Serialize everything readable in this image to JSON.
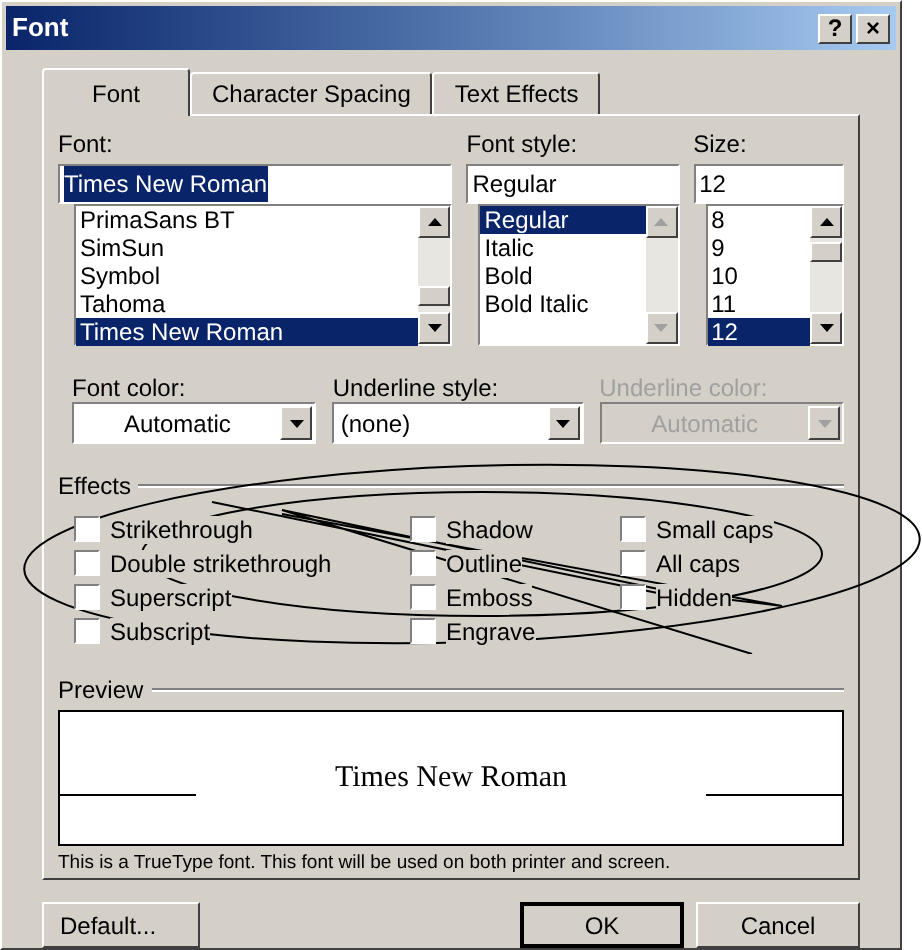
{
  "window": {
    "title": "Font",
    "buttons": [
      "?",
      "×"
    ]
  },
  "tabs": [
    {
      "label": "Font",
      "selected": true
    },
    {
      "label": "Character Spacing",
      "selected": false
    },
    {
      "label": "Text Effects",
      "selected": false
    }
  ],
  "font": {
    "label": "Font:",
    "value": "Times New Roman",
    "items": [
      {
        "label": "PrimaSans BT",
        "selected": false
      },
      {
        "label": "SimSun",
        "selected": false
      },
      {
        "label": "Symbol",
        "selected": false
      },
      {
        "label": "Tahoma",
        "selected": false
      },
      {
        "label": "Times New Roman",
        "selected": true
      }
    ]
  },
  "font_style": {
    "label": "Font style:",
    "value": "Regular",
    "items": [
      {
        "label": "Regular",
        "selected": true
      },
      {
        "label": "Italic",
        "selected": false
      },
      {
        "label": "Bold",
        "selected": false
      },
      {
        "label": "Bold Italic",
        "selected": false
      }
    ]
  },
  "size": {
    "label": "Size:",
    "value": "12",
    "items": [
      {
        "label": "8",
        "selected": false
      },
      {
        "label": "9",
        "selected": false
      },
      {
        "label": "10",
        "selected": false
      },
      {
        "label": "11",
        "selected": false
      },
      {
        "label": "12",
        "selected": true
      }
    ]
  },
  "combos": [
    {
      "label": "Font color:",
      "value": "Automatic",
      "disabled": false
    },
    {
      "label": "Underline style:",
      "value": "(none)",
      "disabled": false
    },
    {
      "label": "Underline color:",
      "value": "Automatic",
      "disabled": true
    }
  ],
  "effects": {
    "label": "Effects",
    "columns": [
      [
        {
          "label": "Strikethrough",
          "checked": false
        },
        {
          "label": "Double strikethrough",
          "checked": false
        },
        {
          "label": "Superscript",
          "checked": false
        },
        {
          "label": "Subscript",
          "checked": false
        }
      ],
      [
        {
          "label": "Shadow",
          "checked": false
        },
        {
          "label": "Outline",
          "checked": false
        },
        {
          "label": "Emboss",
          "checked": false
        },
        {
          "label": "Engrave",
          "checked": false
        }
      ],
      [
        {
          "label": "Small caps",
          "checked": false
        },
        {
          "label": "All caps",
          "checked": false
        },
        {
          "label": "Hidden",
          "checked": false
        }
      ]
    ]
  },
  "preview": {
    "label": "Preview",
    "sample": "Times New Roman",
    "note": "This is a TrueType font. This font will be used on both printer and screen."
  },
  "buttons": [
    "Default...",
    "OK",
    "Cancel"
  ]
}
